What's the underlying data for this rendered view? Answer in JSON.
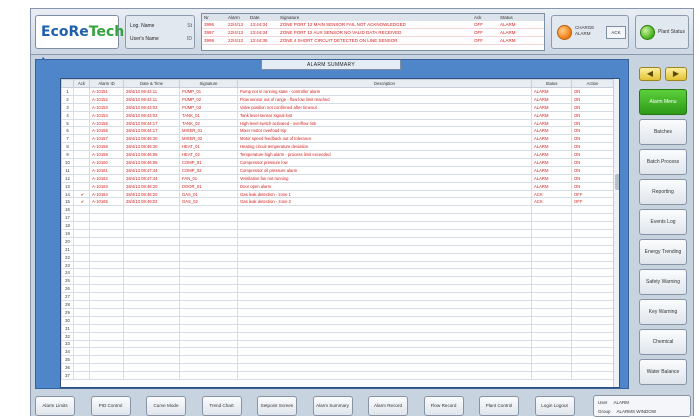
{
  "header": {
    "logo": {
      "part1": "EcoRe",
      "part2": "Tech"
    },
    "user": {
      "row1_label": "Log. Name",
      "row1_value": "St",
      "row2_label": "User's Name",
      "row2_value": "ID"
    },
    "alarm_strip": {
      "columns": [
        "Nr",
        "Alarm",
        "Date",
        "Signature",
        "Ack",
        "Status"
      ],
      "rows": [
        {
          "nr": "3996",
          "alarm": "22/4/13",
          "date": "13:44:34",
          "text": "ZONE PORT 12 MAIN SENSOR FAIL NOT ACKNOWLEDGED",
          "ack": "OFF",
          "status": "ALARM"
        },
        {
          "nr": "3997",
          "alarm": "22/4/13",
          "date": "13:44:34",
          "text": "ZONE PORT 12 AUX SENSOR NO VALID DATA RECEIVED",
          "ack": "OFF",
          "status": "ALARM"
        },
        {
          "nr": "3998",
          "alarm": "22/4/13",
          "date": "13:44:35",
          "text": "ZONE 4 SHORT CIRCUIT DETECTED ON LINE SENSOR",
          "ack": "OFF",
          "status": "ALARM"
        }
      ]
    },
    "alarm_indicator": {
      "text": "CHARGE ALARM",
      "ack_label": "ACK"
    },
    "plant_status": {
      "label": "Plant Status"
    }
  },
  "panel": {
    "title": "ALARM SUMMARY",
    "table": {
      "columns": [
        "",
        "Ack",
        "Alarm ID",
        "Date & Time",
        "Signature",
        "Description",
        "Status",
        "Action"
      ],
      "rows": [
        {
          "ack": "",
          "id": "A-10151",
          "time": "28/4/13 08:42:11",
          "sig": "PUMP_01",
          "desc": "Pump not in running state - controller alarm",
          "status": "ALARM",
          "action": "ON"
        },
        {
          "ack": "",
          "id": "A-10152",
          "time": "28/4/13 08:42:11",
          "sig": "PUMP_02",
          "desc": "Flow sensor out of range - flow low limit reached",
          "status": "ALARM",
          "action": "ON"
        },
        {
          "ack": "",
          "id": "A-10153",
          "time": "28/4/13 08:43:02",
          "sig": "PUMP_03",
          "desc": "Valve position not confirmed after timeout",
          "status": "ALARM",
          "action": "ON"
        },
        {
          "ack": "",
          "id": "A-10154",
          "time": "28/4/13 08:43:02",
          "sig": "TANK_01",
          "desc": "Tank level sensor signal lost",
          "status": "ALARM",
          "action": "ON"
        },
        {
          "ack": "",
          "id": "A-10155",
          "time": "28/4/13 08:44:17",
          "sig": "TANK_02",
          "desc": "High level switch activated - overflow risk",
          "status": "ALARM",
          "action": "ON"
        },
        {
          "ack": "",
          "id": "A-10156",
          "time": "28/4/13 08:44:17",
          "sig": "MIXER_01",
          "desc": "Mixer motor overload trip",
          "status": "ALARM",
          "action": "ON"
        },
        {
          "ack": "",
          "id": "A-10157",
          "time": "28/4/13 08:45:30",
          "sig": "MIXER_02",
          "desc": "Motor speed feedback out of tolerance",
          "status": "ALARM",
          "action": "ON"
        },
        {
          "ack": "",
          "id": "A-10158",
          "time": "28/4/13 08:45:30",
          "sig": "HEAT_01",
          "desc": "Heating circuit temperature deviation",
          "status": "ALARM",
          "action": "ON"
        },
        {
          "ack": "",
          "id": "A-10159",
          "time": "28/4/13 08:46:05",
          "sig": "HEAT_02",
          "desc": "Temperature high alarm - process limit exceeded",
          "status": "ALARM",
          "action": "ON"
        },
        {
          "ack": "",
          "id": "A-10160",
          "time": "28/4/13 08:46:05",
          "sig": "COMP_01",
          "desc": "Compressor pressure low",
          "status": "ALARM",
          "action": "ON"
        },
        {
          "ack": "",
          "id": "A-10161",
          "time": "28/4/13 08:47:44",
          "sig": "COMP_02",
          "desc": "Compressor oil pressure alarm",
          "status": "ALARM",
          "action": "ON"
        },
        {
          "ack": "",
          "id": "A-10162",
          "time": "28/4/13 08:47:44",
          "sig": "FAN_01",
          "desc": "Ventilation fan not running",
          "status": "ALARM",
          "action": "ON"
        },
        {
          "ack": "",
          "id": "A-10163",
          "time": "28/4/13 08:48:20",
          "sig": "DOOR_01",
          "desc": "Door open alarm",
          "status": "ALARM",
          "action": "ON"
        },
        {
          "ack": "✔",
          "id": "A-10164",
          "time": "28/4/13 08:48:20",
          "sig": "GAS_01",
          "desc": "Gas leak detection - zone 1",
          "status": "ACK",
          "action": "OFF"
        },
        {
          "ack": "✔",
          "id": "A-10165",
          "time": "28/4/13 08:49:02",
          "sig": "GAS_02",
          "desc": "Gas leak detection - zone 2",
          "status": "ACK",
          "action": "OFF"
        }
      ],
      "empty_rows": 22
    }
  },
  "right_menu": {
    "arrows": [
      "◀",
      "▶"
    ],
    "buttons": [
      "Alarm Menu",
      "Batches",
      "Batch Process",
      "Reporting",
      "Events Log",
      "Energy Trending",
      "Safety Warning",
      "Key Warning",
      "Chemical",
      "Water Balance"
    ],
    "active_index": 0
  },
  "bottom_bar": {
    "buttons": [
      "Alarm Limits",
      "PID Control",
      "Curve Mode",
      "Trend Chart",
      "Setpoint Screen",
      "Alarm Summary",
      "Alarm Record",
      "Flow Record",
      "Plant Control",
      "Login Logout"
    ],
    "status": {
      "row1_label": "User",
      "row1_value": "ALARM",
      "row2_label": "Group",
      "row2_value": "ALARMS WINDOW"
    }
  }
}
